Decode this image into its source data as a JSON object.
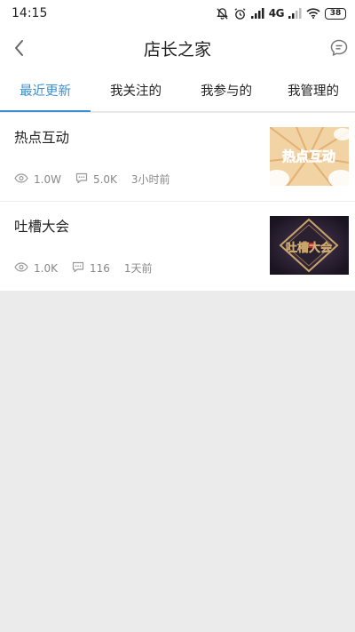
{
  "status_bar": {
    "time": "14:15",
    "network": "4G",
    "battery": "38"
  },
  "nav": {
    "title": "店长之家"
  },
  "tabs": [
    {
      "label": "最近更新",
      "active": true
    },
    {
      "label": "我关注的",
      "active": false
    },
    {
      "label": "我参与的",
      "active": false
    },
    {
      "label": "我管理的",
      "active": false
    }
  ],
  "items": [
    {
      "title": "热点互动",
      "views": "1.0W",
      "comments": "5.0K",
      "time": "3小时前",
      "thumb_text": "热点互动"
    },
    {
      "title": "吐槽大会",
      "views": "1.0K",
      "comments": "116",
      "time": "1天前",
      "thumb_text": "吐槽大会"
    }
  ],
  "colors": {
    "accent": "#3b8fd0",
    "background": "#ebebeb"
  }
}
